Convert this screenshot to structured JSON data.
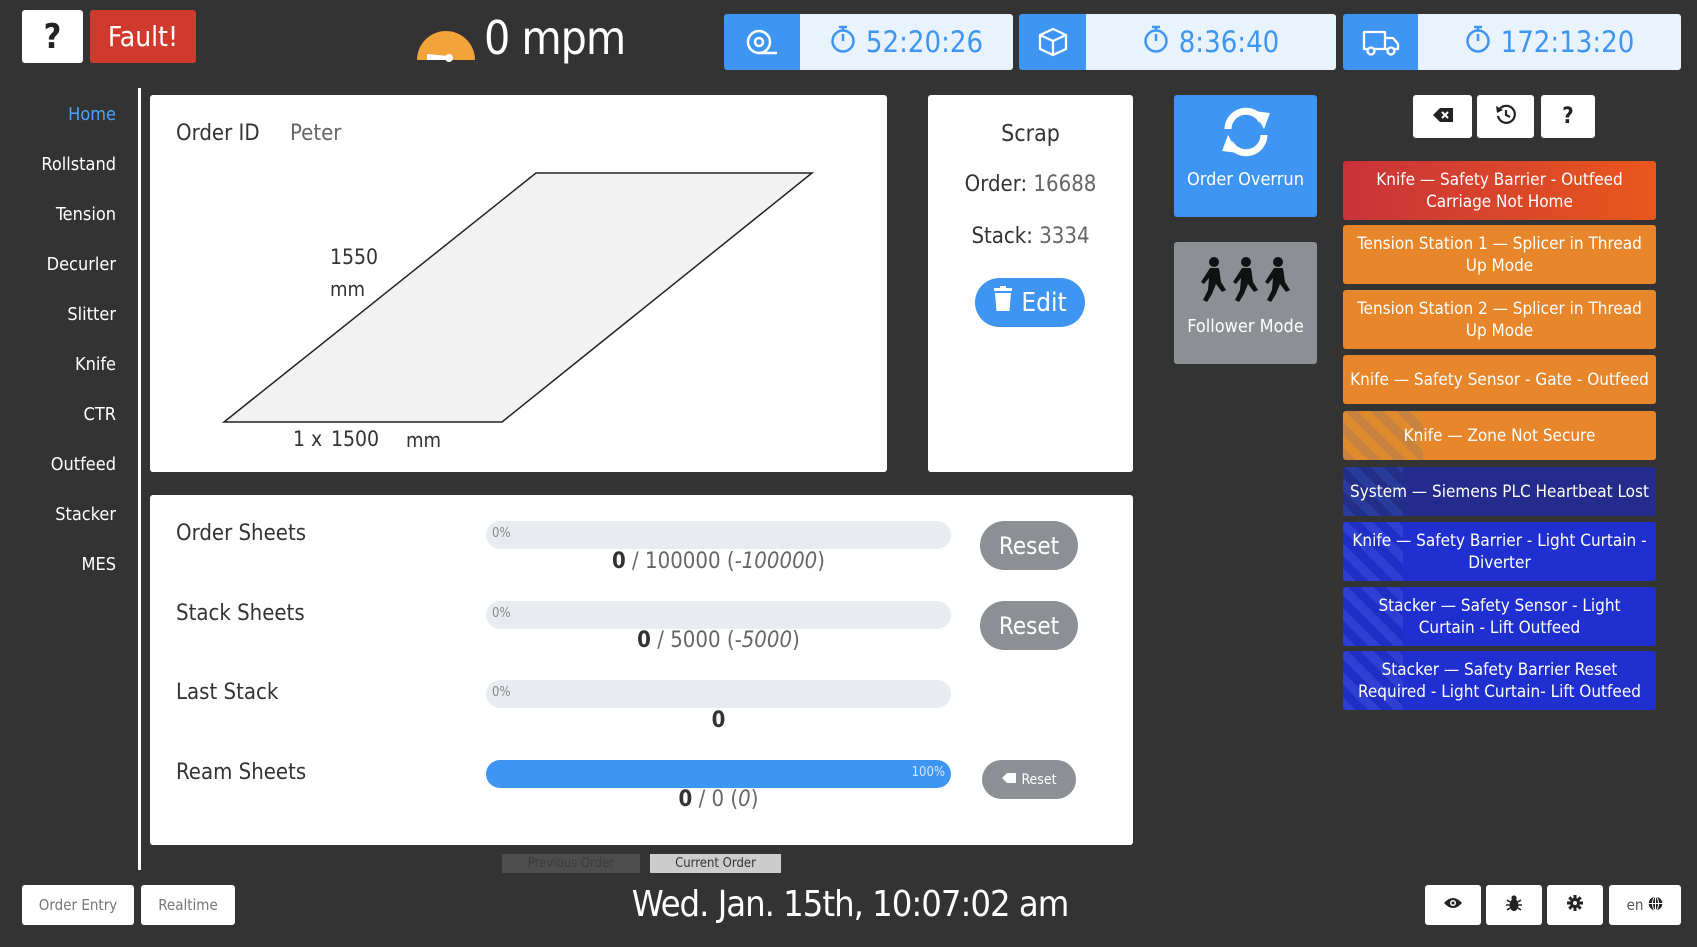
{
  "topbar": {
    "help_label": "?",
    "fault_label": "Fault!",
    "speed_value": "0",
    "speed_unit": "mpm",
    "timers": [
      {
        "icon": "roll-icon",
        "value": "52:20:26"
      },
      {
        "icon": "box-icon",
        "value": "8:36:40"
      },
      {
        "icon": "truck-icon",
        "value": "172:13:20"
      }
    ]
  },
  "sidebar": {
    "items": [
      {
        "label": "Home",
        "active": true
      },
      {
        "label": "Rollstand"
      },
      {
        "label": "Tension"
      },
      {
        "label": "Decurler"
      },
      {
        "label": "Slitter"
      },
      {
        "label": "Knife"
      },
      {
        "label": "CTR"
      },
      {
        "label": "Outfeed"
      },
      {
        "label": "Stacker"
      },
      {
        "label": "MES"
      }
    ]
  },
  "order": {
    "id_label": "Order ID",
    "id_value": "Peter",
    "height_value": "1550",
    "height_unit": "mm",
    "width_multiplier": "1 x",
    "width_value": "1500",
    "width_unit": "mm"
  },
  "scrap": {
    "title": "Scrap",
    "order_label": "Order",
    "order_value": "16688",
    "stack_label": "Stack",
    "stack_value": "3334",
    "edit_label": "Edit"
  },
  "actions": {
    "overrun_label": "Order Overrun",
    "follower_label": "Follower Mode"
  },
  "counters": {
    "order_sheets": {
      "label": "Order Sheets",
      "progress": 0,
      "pct": "0%",
      "current": "0",
      "target": "100000",
      "remaining": "-100000",
      "reset_label": "Reset"
    },
    "stack_sheets": {
      "label": "Stack Sheets",
      "progress": 0,
      "pct": "0%",
      "current": "0",
      "target": "5000",
      "remaining": "-5000",
      "reset_label": "Reset"
    },
    "last_stack": {
      "label": "Last Stack",
      "progress": 0,
      "pct": "0%",
      "current": "0"
    },
    "ream_sheets": {
      "label": "Ream Sheets",
      "progress": 100,
      "pct": "100%",
      "current": "0",
      "target": "0",
      "remaining": "0",
      "reset_label": "Reset"
    }
  },
  "order_tabs": {
    "previous": "Previous Order",
    "current": "Current Order"
  },
  "alert_tools": [
    "eraser-icon",
    "history-icon",
    "help-icon"
  ],
  "alerts": [
    {
      "text": "Knife — Safety Barrier - Outfeed Carriage Not Home",
      "level": "critical"
    },
    {
      "text": "Tension Station 1 — Splicer in Thread Up Mode",
      "level": "warning"
    },
    {
      "text": "Tension Station 2 — Splicer in Thread Up Mode",
      "level": "warning"
    },
    {
      "text": "Knife — Safety Sensor - Gate - Outfeed",
      "level": "warning"
    },
    {
      "text": "Knife — Zone Not Secure",
      "level": "warning"
    },
    {
      "text": "System — Siemens PLC Heartbeat Lost",
      "level": "info"
    },
    {
      "text": "Knife — Safety Barrier - Light Curtain - Diverter",
      "level": "info"
    },
    {
      "text": "Stacker — Safety Sensor - Light Curtain - Lift Outfeed",
      "level": "info"
    },
    {
      "text": "Stacker — Safety Barrier Reset Required - Light Curtain- Lift Outfeed",
      "level": "info"
    }
  ],
  "footer": {
    "order_entry_label": "Order Entry",
    "realtime_label": "Realtime",
    "datetime": "Wed. Jan. 15th, 10:07:02 am",
    "language": "en"
  },
  "colors": {
    "accent": "#3f95f2",
    "critical": "#d0352f",
    "warning": "#e8862c",
    "info": "#1f2fd0"
  }
}
